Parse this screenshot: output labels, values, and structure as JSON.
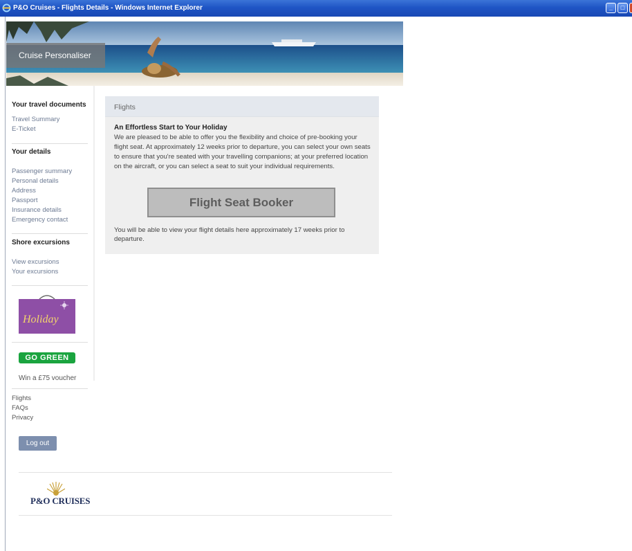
{
  "window": {
    "title": "P&O Cruises - Flights Details - Windows Internet Explorer"
  },
  "banner": {
    "label": "Cruise Personaliser"
  },
  "sidebar": {
    "travel_documents": {
      "heading": "Your travel documents",
      "links": [
        "Travel Summary",
        "E-Ticket"
      ]
    },
    "your_details": {
      "heading": "Your details",
      "links": [
        "Passenger summary",
        "Personal details",
        "Address",
        "Passport",
        "Insurance details",
        "Emergency contact"
      ]
    },
    "shore_excursions": {
      "heading": "Shore excursions",
      "links": [
        "View excursions",
        "Your excursions"
      ]
    },
    "holiday_badge": "Holiday",
    "go_green": "GO GREEN",
    "voucher": "Win a £75 voucher",
    "footer_links": [
      "Flights",
      "FAQs",
      "Privacy"
    ],
    "logout": "Log out"
  },
  "panel": {
    "title": "Flights",
    "heading": "An Effortless Start to Your Holiday",
    "intro": "We are pleased to be able to offer you the flexibility and choice of pre-booking your flight seat. At approximately 12 weeks prior to departure, you can select your own seats to ensure that you're seated with your travelling companions; at your preferred location on the aircraft, or you can select a seat to suit your individual requirements.",
    "seat_booker": "Flight Seat Booker",
    "note": "You will be able to view your flight details here approximately 17 weeks prior to departure."
  },
  "footer": {
    "logo": "P&O CRUISES"
  },
  "colors": {
    "titlebar": "#1f55c5",
    "link": "#6c7a93",
    "panel_bg": "#efefef",
    "go_green": "#1aa43f",
    "holiday_badge": "#8e4fa6",
    "logout": "#7d8fae"
  }
}
